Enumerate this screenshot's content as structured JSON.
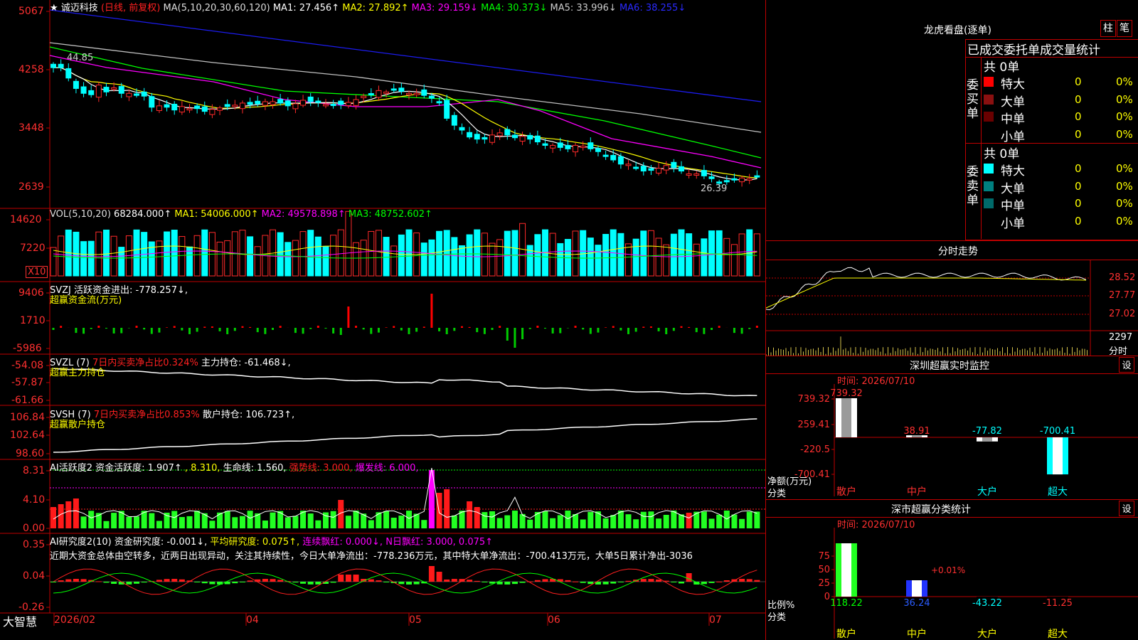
{
  "colors": {
    "up": "#ff2a2a",
    "down": "#00ffff",
    "vol_up": "#ff2a2a",
    "vol_down": "#00ffff",
    "grid": "#aa0000",
    "ma1": "#ffffff",
    "ma2": "#ffff00",
    "ma3": "#ff00ff",
    "ma4": "#00ff00",
    "ma5": "#c0c0c0",
    "ma6": "#1c1cf0",
    "ai_up": "#ff1a1a",
    "ai_down": "#22ff22"
  },
  "main": {
    "title_star": "★",
    "name": "诚迈科技",
    "period": "(日线, 前复权)",
    "ma_params": "MA(5,10,20,30,60,120)",
    "ma1": "MA1: 27.456↑",
    "ma2": "MA2: 27.892↑",
    "ma3": "MA3: 29.159↓",
    "ma4": "MA4: 30.373↓",
    "ma5": "MA5: 33.996↓",
    "ma6": "MA6: 38.255↓",
    "yticks": [
      "5067",
      "4258",
      "3448",
      "2639"
    ],
    "high_label": "44.85",
    "low_label": "26.39"
  },
  "vol": {
    "title": "VOL(5,10,20)",
    "v": "68284.000↑",
    "ma1": "MA1: 54006.000↑",
    "ma2": "MA2: 49578.898↑",
    "ma3": "MA3: 48752.602↑",
    "yticks": [
      "14620",
      "7220"
    ],
    "unit": "X10"
  },
  "svzj": {
    "title": "SVZJ  活跃资金进出: -778.257↓,",
    "sub": "超赢资金流(万元)",
    "yticks": [
      "9406",
      "1710",
      "-5986"
    ]
  },
  "svzl": {
    "title": "SVZL (7)",
    "red": "7日内买卖净占比0.324%",
    "rest": "主力持仓: -61.468↓,",
    "sub": "超赢主力持仓",
    "yticks": [
      "-54.08",
      "-57.87",
      "-61.66"
    ]
  },
  "svsh": {
    "title": "SVSH (7)",
    "red": "7日内买卖净占比0.853%",
    "rest": "散户持仓: 106.723↑,",
    "sub": "超赢散户持仓",
    "yticks": [
      "106.84",
      "102.64",
      "98.60"
    ]
  },
  "ai1": {
    "t1": "AI活跃度2 资金活跃度: 1.907↑",
    "t2": ", 8.310,",
    "t3": "生命线: 1.560,",
    "t4": "强势线: 3.000,",
    "t5": "爆发线: 6.000,",
    "yticks": [
      "8.31",
      "4.10",
      "0.00"
    ]
  },
  "ai2": {
    "t1": "AI研究度2(10) 资金研究度: -0.001↓,",
    "t2": "平均研究度: 0.075↑,",
    "t3": "连续飘红: 0.000↓,",
    "t4": "N日飘红: 3.000, 0.075↑",
    "text": "近期大资金总体由空转多，近两日出现异动，关注其持续性，今日大单净流出：-778.236万元，其中特大单净流出：-700.413万元，大单5日累计净出-3036",
    "yticks": [
      "0.35",
      "0.04",
      "-0.26"
    ]
  },
  "xaxis": {
    "logo": "大智慧",
    "labels": [
      "2026/02",
      "04",
      "05",
      "06",
      "07"
    ]
  },
  "lhb": {
    "title": "龙虎看盘(逐单)",
    "btn1": "柱",
    "btn2": "笔",
    "header": "已成交委托单成交量统计",
    "buy": {
      "side": "委买单",
      "total": "共 0单",
      "rows": [
        {
          "name": "特大",
          "v": "0",
          "p": "0%",
          "c": "#ff0000"
        },
        {
          "name": "大单",
          "v": "0",
          "p": "0%",
          "c": "#8a1010"
        },
        {
          "name": "中单",
          "v": "0",
          "p": "0%",
          "c": "#6a0000"
        },
        {
          "name": "小单",
          "v": "0",
          "p": "0%",
          "c": "#000000"
        }
      ]
    },
    "sell": {
      "side": "委卖单",
      "total": "共 0单",
      "rows": [
        {
          "name": "特大",
          "v": "0",
          "p": "0%",
          "c": "#00ffff"
        },
        {
          "name": "大单",
          "v": "0",
          "p": "0%",
          "c": "#008080"
        },
        {
          "name": "中单",
          "v": "0",
          "p": "0%",
          "c": "#006a6a"
        },
        {
          "name": "小单",
          "v": "0",
          "p": "0%",
          "c": "#000000"
        }
      ]
    }
  },
  "fenshi": {
    "title": "分时走势",
    "yticks": [
      "28.52",
      "27.77",
      "27.02"
    ],
    "vol_tick": "2297",
    "vol_label": "分时"
  },
  "sz_monitor": {
    "title": "深圳超赢实时监控",
    "btn": "设",
    "time": "时间: 2026/07/10",
    "yticks": [
      "739.32",
      "259.41",
      "-220.5",
      "-700.41"
    ],
    "ylabel": "净额(万元)",
    "xlabel": "分类",
    "chart_data": {
      "type": "bar",
      "categories": [
        "散户",
        "中户",
        "大户",
        "超大"
      ],
      "values": [
        739.32,
        38.91,
        -77.82,
        -700.41
      ],
      "value_labels": [
        "739.32",
        "38.91",
        "-77.82",
        "-700.41"
      ],
      "ylim": [
        -700.41,
        739.32
      ]
    }
  },
  "sz_class": {
    "title": "深市超赢分类统计",
    "btn": "设",
    "time": "时间: 2026/07/10",
    "yticks": [
      "75",
      "50",
      "25",
      "0"
    ],
    "ylabel": "比例%",
    "xlabel": "分类",
    "extra": "+0.01%",
    "chart_data": {
      "type": "bar",
      "categories": [
        "散户",
        "中户",
        "大户",
        "超大"
      ],
      "values": [
        118.22,
        36.24,
        -43.22,
        -11.25
      ],
      "value_labels": [
        "118.22",
        "36.24",
        "-43.22",
        "-11.25"
      ]
    }
  }
}
